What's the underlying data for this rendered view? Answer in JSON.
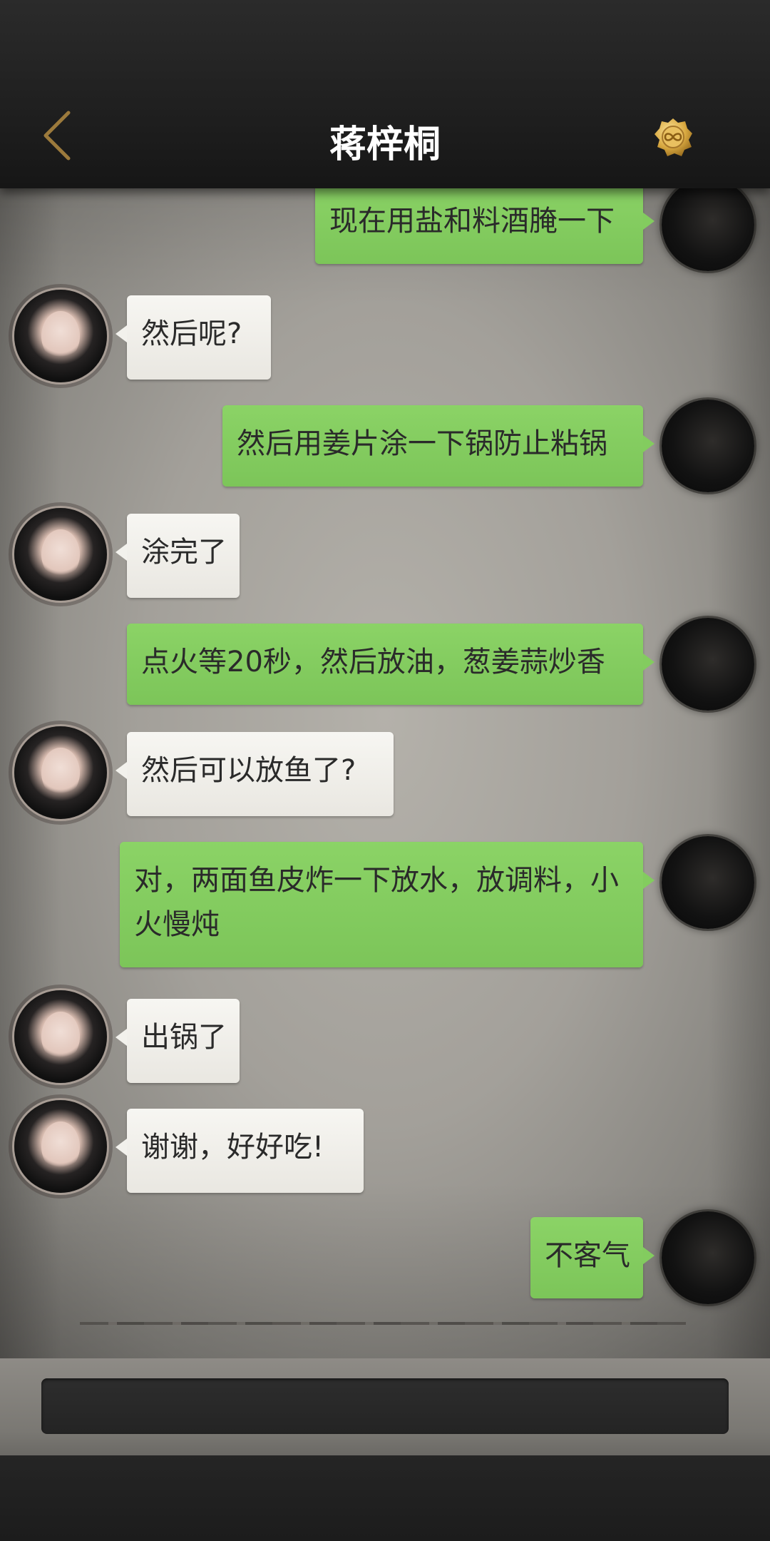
{
  "header": {
    "title": "蒋梓桐",
    "back_icon": "chevron-left-icon",
    "coin_icon": "infinity-coin-icon",
    "accent_color": "#d4aa55"
  },
  "colors": {
    "outgoing_bubble": "#83cc5f",
    "incoming_bubble": "#f2f1ec"
  },
  "messages": [
    {
      "from": "me",
      "text": "现在用盐和料酒腌一下"
    },
    {
      "from": "her",
      "text": "然后呢?"
    },
    {
      "from": "me",
      "text": "然后用姜片涂一下锅防止粘锅"
    },
    {
      "from": "her",
      "text": "涂完了"
    },
    {
      "from": "me",
      "text": "点火等20秒，然后放油，葱姜蒜炒香"
    },
    {
      "from": "her",
      "text": "然后可以放鱼了?"
    },
    {
      "from": "me",
      "text": "对，两面鱼皮炸一下放水，放调料，小火慢炖"
    },
    {
      "from": "her",
      "text": "出锅了"
    },
    {
      "from": "her",
      "text": "谢谢，好好吃!"
    },
    {
      "from": "me",
      "text": "不客气"
    }
  ]
}
